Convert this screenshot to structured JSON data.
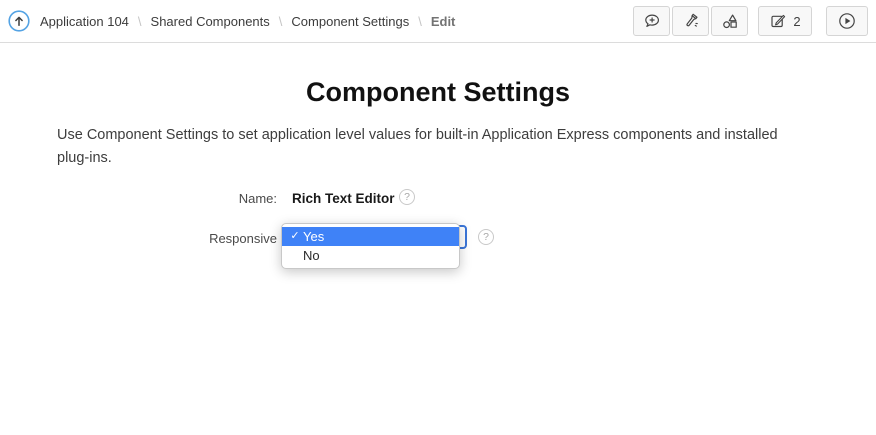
{
  "breadcrumb": {
    "separator": "\\",
    "items": [
      "Application 104",
      "Shared Components",
      "Component Settings"
    ],
    "current": "Edit"
  },
  "toolbar": {
    "edit_count": "2",
    "icons": [
      "comment-plus",
      "flashlight-search",
      "shared-components-shapes",
      "edit-page",
      "run-play"
    ]
  },
  "page": {
    "title": "Component Settings",
    "description": "Use Component Settings to set application level values for built-in Application Express components and installed plug-ins."
  },
  "form": {
    "name_label": "Name:",
    "name_value": "Rich Text Editor",
    "responsive_label": "Responsive",
    "help_glyph": "?",
    "dropdown": {
      "checkmark": "✓",
      "options": [
        {
          "label": "Yes",
          "selected": true
        },
        {
          "label": "No",
          "selected": false
        }
      ]
    }
  },
  "colors": {
    "highlight_blue": "#3f82f7",
    "focus_ring_blue": "#3b76d9",
    "up_circle_blue": "#54a3e4"
  }
}
